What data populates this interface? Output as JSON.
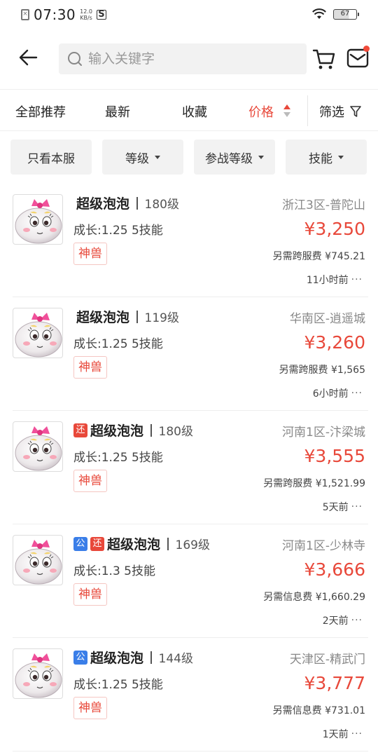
{
  "status_bar": {
    "time": "07:30",
    "speed_value": "12.0",
    "speed_unit": "KB/s",
    "battery": "67"
  },
  "search": {
    "placeholder": "输入关键字"
  },
  "sort_tabs": {
    "all": "全部推荐",
    "latest": "最新",
    "favorites": "收藏",
    "price": "价格",
    "filter": "筛选"
  },
  "chips": {
    "this_server": "只看本服",
    "level": "等级",
    "battle_level": "参战等级",
    "skills": "技能"
  },
  "accent_color": "#e8483a",
  "items": [
    {
      "name": "超级泡泡",
      "level": "180级",
      "tags": [],
      "growth": "成长:1.25 5技能",
      "badge": "神兽",
      "server": "浙江3区-普陀山",
      "price": "¥3,250",
      "fee": "另需跨服费 ¥745.21",
      "time": "11小时前"
    },
    {
      "name": "超级泡泡",
      "level": "119级",
      "tags": [],
      "growth": "成长:1.25 5技能",
      "badge": "神兽",
      "server": "华南区-逍遥城",
      "price": "¥3,260",
      "fee": "另需跨服费 ¥1,565",
      "time": "6小时前"
    },
    {
      "name": "超级泡泡",
      "level": "180级",
      "tags": [
        "还"
      ],
      "growth": "成长:1.25 5技能",
      "badge": "神兽",
      "server": "河南1区-汴梁城",
      "price": "¥3,555",
      "fee": "另需跨服费 ¥1,521.99",
      "time": "5天前"
    },
    {
      "name": "超级泡泡",
      "level": "169级",
      "tags": [
        "公",
        "还"
      ],
      "growth": "成长:1.3 5技能",
      "badge": "神兽",
      "server": "河南1区-少林寺",
      "price": "¥3,666",
      "fee": "另需信息费 ¥1,660.29",
      "time": "2天前"
    },
    {
      "name": "超级泡泡",
      "level": "144级",
      "tags": [
        "公"
      ],
      "growth": "成长:1.25 5技能",
      "badge": "神兽",
      "server": "天津区-精武门",
      "price": "¥3,777",
      "fee": "另需信息费 ¥731.01",
      "time": "1天前"
    }
  ]
}
